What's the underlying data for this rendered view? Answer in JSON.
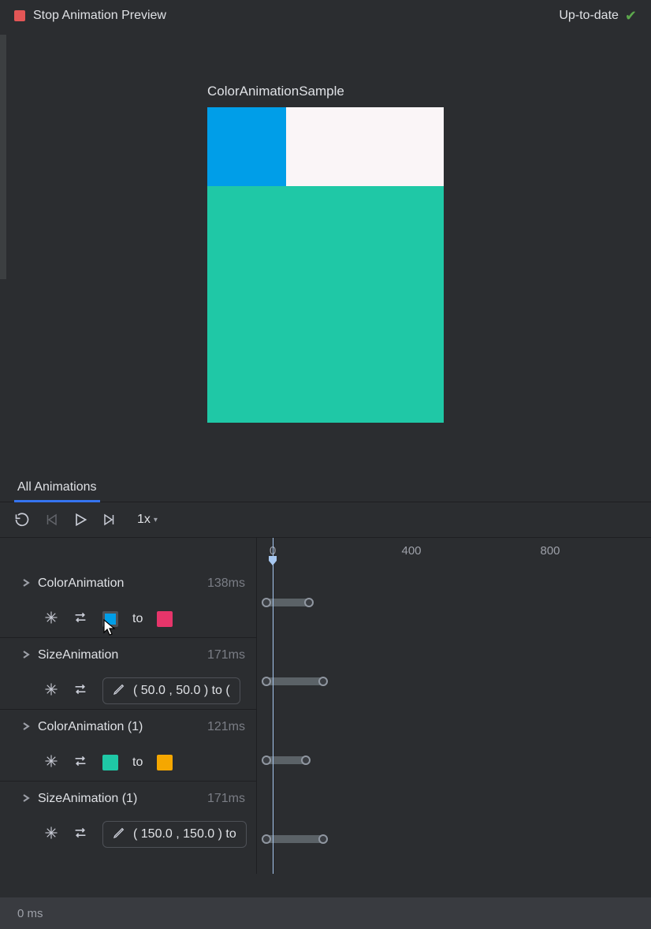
{
  "toolbar": {
    "title": "Stop Animation Preview",
    "status": "Up-to-date"
  },
  "preview": {
    "label": "ColorAnimationSample",
    "squares": {
      "small_color": "#009ee8",
      "large_color": "#1fc8a6",
      "bg_color": "#faf5f7"
    }
  },
  "tabs": {
    "active": "All Animations"
  },
  "controls": {
    "speed": "1x"
  },
  "axis": {
    "ticks": [
      "0",
      "400",
      "800"
    ]
  },
  "animations": [
    {
      "name": "ColorAnimation",
      "duration": "138ms",
      "from_color": "#009ee8",
      "to_label": "to",
      "to_color": "#e6356a",
      "type": "color"
    },
    {
      "name": "SizeAnimation",
      "duration": "171ms",
      "value": "( 50.0 , 50.0 ) to (",
      "type": "size"
    },
    {
      "name": "ColorAnimation (1)",
      "duration": "121ms",
      "from_color": "#1fc8a6",
      "to_label": "to",
      "to_color": "#f5a700",
      "type": "color"
    },
    {
      "name": "SizeAnimation (1)",
      "duration": "171ms",
      "value": "( 150.0 , 150.0 ) to",
      "type": "size"
    }
  ],
  "footer": {
    "time": "0 ms"
  }
}
